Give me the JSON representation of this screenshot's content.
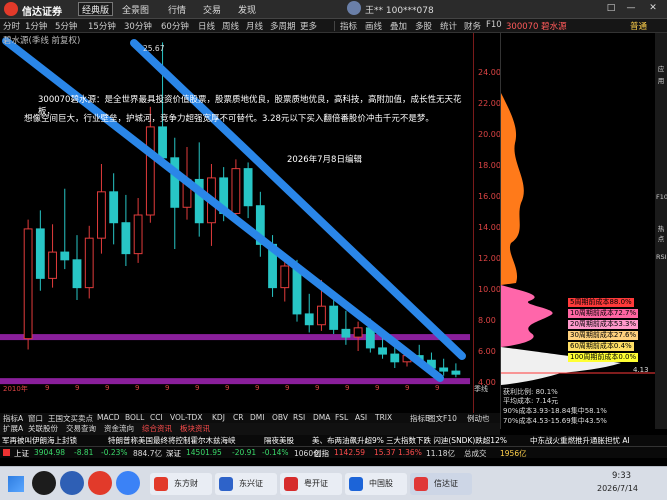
{
  "app": {
    "brand": "信达证券",
    "version_select": "经典版",
    "menu": [
      "全景图",
      "行情",
      "交易",
      "发现"
    ],
    "user": "王**  100***078",
    "window_buttons": [
      "□",
      "—",
      "✕"
    ]
  },
  "toolbar": {
    "periods": [
      "分时",
      "1分钟",
      "5分钟",
      "15分钟",
      "30分钟",
      "60分钟",
      "日线",
      "周线",
      "月线",
      "多周期",
      "更多"
    ],
    "active_period": "季线",
    "tools": [
      "指标",
      "画线",
      "叠加",
      "多股",
      "统计",
      "财务",
      "F10"
    ],
    "stock_header": "300070 碧水源",
    "status": "普通"
  },
  "chart": {
    "title": "碧水源(季线 前复权)",
    "high_label": "25.67",
    "date_label": "2026年7月8日编辑",
    "annotation_line1": "300070碧水源：是全世界最具投资价值股票，股票质地优良，股票质地优良，高科技，高附加值，成长性无天花板，",
    "annotation_line2": "想像空间巨大，行业壁垒，护城河，竞争力超强宽厚不可替代。3.28元以下买入翻倍番股价冲击千元不是梦。",
    "y_ticks": [
      "24.00",
      "22.00",
      "20.00",
      "18.00",
      "16.00",
      "14.00",
      "12.00",
      "10.00",
      "8.00",
      "6.00",
      "4.00"
    ],
    "year_labels": [
      "2010年",
      "9",
      "9",
      "9",
      "9",
      "9",
      "9",
      "9",
      "9",
      "9",
      "9",
      "9",
      "9",
      "9",
      "9"
    ],
    "axis_left_label": "季线"
  },
  "chart_data": {
    "type": "candlestick",
    "title": "碧水源(季线 前复权)",
    "ylim": [
      3.5,
      25.5
    ],
    "candles": [
      {
        "o": 6.5,
        "h": 14.2,
        "l": 5.8,
        "c": 13.6
      },
      {
        "o": 13.6,
        "h": 14.8,
        "l": 9.6,
        "c": 10.4
      },
      {
        "o": 10.4,
        "h": 13.9,
        "l": 9.8,
        "c": 12.1
      },
      {
        "o": 12.1,
        "h": 16.2,
        "l": 11.0,
        "c": 11.6
      },
      {
        "o": 11.6,
        "h": 13.2,
        "l": 9.0,
        "c": 9.8
      },
      {
        "o": 9.8,
        "h": 13.8,
        "l": 9.1,
        "c": 13.0
      },
      {
        "o": 13.0,
        "h": 17.8,
        "l": 12.0,
        "c": 16.0
      },
      {
        "o": 16.0,
        "h": 17.2,
        "l": 12.6,
        "c": 14.0
      },
      {
        "o": 14.0,
        "h": 15.8,
        "l": 11.2,
        "c": 12.0
      },
      {
        "o": 12.0,
        "h": 15.6,
        "l": 11.4,
        "c": 14.5
      },
      {
        "o": 14.5,
        "h": 21.5,
        "l": 14.0,
        "c": 20.2
      },
      {
        "o": 20.2,
        "h": 25.67,
        "l": 17.6,
        "c": 18.2
      },
      {
        "o": 18.2,
        "h": 19.5,
        "l": 12.3,
        "c": 15.0
      },
      {
        "o": 15.0,
        "h": 18.9,
        "l": 14.2,
        "c": 16.8
      },
      {
        "o": 16.8,
        "h": 19.2,
        "l": 13.1,
        "c": 14.0
      },
      {
        "o": 14.0,
        "h": 17.8,
        "l": 12.5,
        "c": 16.9
      },
      {
        "o": 16.9,
        "h": 17.6,
        "l": 14.1,
        "c": 14.6
      },
      {
        "o": 14.6,
        "h": 18.1,
        "l": 14.0,
        "c": 17.5
      },
      {
        "o": 17.5,
        "h": 17.9,
        "l": 14.3,
        "c": 15.1
      },
      {
        "o": 15.1,
        "h": 16.0,
        "l": 11.8,
        "c": 12.6
      },
      {
        "o": 12.6,
        "h": 13.2,
        "l": 9.2,
        "c": 9.8
      },
      {
        "o": 9.8,
        "h": 12.0,
        "l": 8.9,
        "c": 11.2
      },
      {
        "o": 11.2,
        "h": 11.6,
        "l": 7.6,
        "c": 8.1
      },
      {
        "o": 8.1,
        "h": 9.4,
        "l": 6.9,
        "c": 7.4
      },
      {
        "o": 7.4,
        "h": 10.3,
        "l": 7.0,
        "c": 8.6
      },
      {
        "o": 8.6,
        "h": 9.2,
        "l": 6.8,
        "c": 7.1
      },
      {
        "o": 7.1,
        "h": 8.3,
        "l": 6.1,
        "c": 6.6
      },
      {
        "o": 6.6,
        "h": 7.6,
        "l": 5.7,
        "c": 7.2
      },
      {
        "o": 7.2,
        "h": 7.8,
        "l": 5.6,
        "c": 5.9
      },
      {
        "o": 5.9,
        "h": 6.6,
        "l": 5.2,
        "c": 5.5
      },
      {
        "o": 5.5,
        "h": 6.3,
        "l": 4.6,
        "c": 5.0
      },
      {
        "o": 5.0,
        "h": 5.9,
        "l": 4.7,
        "c": 5.4
      },
      {
        "o": 5.4,
        "h": 6.1,
        "l": 4.9,
        "c": 5.1
      },
      {
        "o": 5.1,
        "h": 5.6,
        "l": 4.3,
        "c": 4.6
      },
      {
        "o": 4.6,
        "h": 5.2,
        "l": 4.1,
        "c": 4.4
      },
      {
        "o": 4.4,
        "h": 4.9,
        "l": 4.0,
        "c": 4.2
      }
    ],
    "up_color": "#e23c3c",
    "down_color": "#28c6c6"
  },
  "right_panel": {
    "cost_labels": [
      {
        "text": "5周期前成本88.0%",
        "color": "#ff3a3a"
      },
      {
        "text": "10周期前成本72.7%",
        "color": "#ff66a3"
      },
      {
        "text": "20周期前成本53.3%",
        "color": "#ff99cc"
      },
      {
        "text": "30周期前成本27.6%",
        "color": "#ffd27f"
      },
      {
        "text": "60周期前成本0.4%",
        "color": "#ffe066"
      },
      {
        "text": "100周期前成本0.0%",
        "color": "#ffff33"
      }
    ],
    "profit_ratio": "获利比例: 80.1%",
    "avg_cost": "平均成本: 7.14元",
    "cost_90": "90%成本3.93-18.84集中58.1%",
    "cost_70": "70%成本4.53-15.69集中43.5%",
    "mid_price": "4.13"
  },
  "side_tabs": [
    "应",
    "用",
    "F10",
    "热",
    "点",
    "RSI"
  ],
  "bottom_tabs1": [
    "指标A",
    "窗口",
    "王国文买卖点",
    "MACD",
    "BOLL",
    "CCI",
    "VOL-TDX",
    "KDJ",
    "CR",
    "DMI",
    "OBV",
    "RSI",
    "DMA",
    "FSL",
    "ASI",
    "TRIX"
  ],
  "bottom_tabs2": [
    "扩展A",
    "关联股份",
    "交易查询",
    "资金流向",
    "综合资讯",
    "板块资讯"
  ],
  "bottom_right_tabs": [
    "指标B",
    "图文F10",
    "例动也"
  ],
  "news": [
    "军再被叫伊朗海上封锁",
    "特朗普称美国最终将控制霍尔木兹海峡",
    "隔夜美股",
    "美、布两油飙升超9%",
    "三大指数下跌 闪迪(SNDK)跌超12%",
    "中东战火重燃推升通胀担忧 AI"
  ],
  "ticker": {
    "sh_label": "上证",
    "sh_price": "3904.98",
    "sh_chg": "-8.81",
    "sh_pct": "-0.23%",
    "sh_vol": "884.7亿",
    "sz_label": "深证",
    "sz_price": "14501.95",
    "sz_chg": "-20.91",
    "sz_pct": "-0.14%",
    "sz_vol": "1060亿",
    "cy_label": "创指",
    "cy_price": "1142.59",
    "cy_chg": "15.37",
    "cy_pct": "1.36%",
    "total_vol": "11.18亿",
    "total_label": "总成交",
    "total_amt": "1956亿"
  },
  "taskbar": {
    "apps": [
      "东方财富...",
      "东兴证券...",
      "粤开证券...",
      "中国股民...",
      "信达证券..."
    ],
    "time": "9:33",
    "date": "2026/7/14"
  }
}
